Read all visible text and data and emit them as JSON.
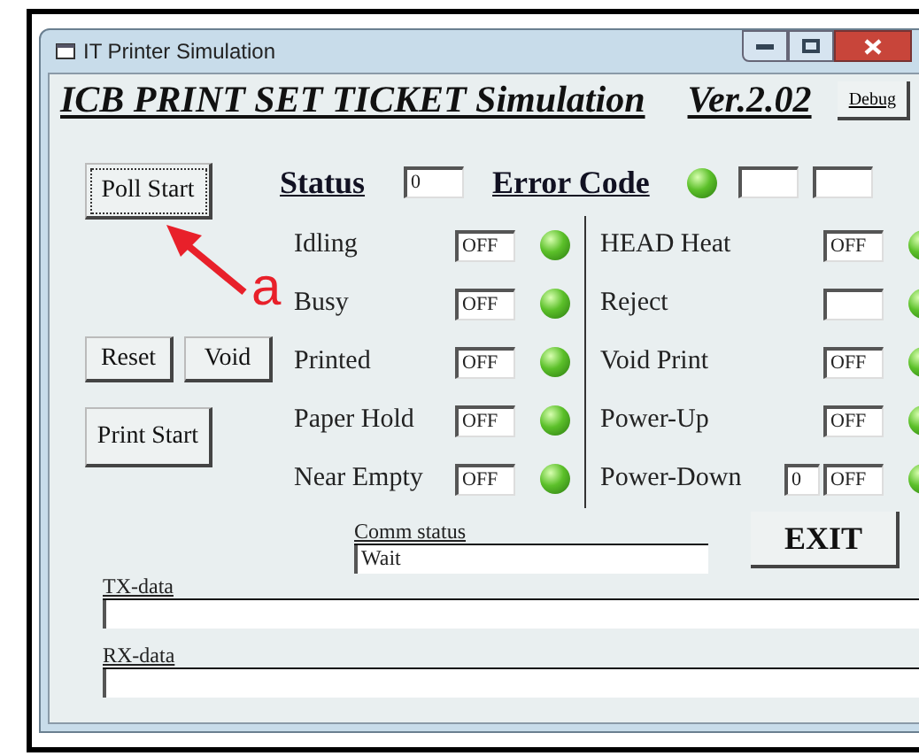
{
  "window": {
    "title": "IT Printer Simulation"
  },
  "header": {
    "title": "ICB PRINT SET TICKET Simulation",
    "version": "Ver.2.02",
    "debug_button": "Debug"
  },
  "buttons": {
    "poll_start": "Poll Start",
    "reset": "Reset",
    "void": "Void",
    "print_start": "Print Start",
    "exit": "EXIT"
  },
  "annotation": {
    "label": "a"
  },
  "status": {
    "label": "Status",
    "value": "0"
  },
  "error_code": {
    "label": "Error Code"
  },
  "indicators_left": [
    {
      "label": "Idling",
      "value": "OFF"
    },
    {
      "label": "Busy",
      "value": "OFF"
    },
    {
      "label": "Printed",
      "value": "OFF"
    },
    {
      "label": "Paper Hold",
      "value": "OFF"
    },
    {
      "label": "Near Empty",
      "value": "OFF"
    }
  ],
  "indicators_right": [
    {
      "label": "HEAD Heat",
      "value": "OFF"
    },
    {
      "label": "Reject"
    },
    {
      "label": "Void Print",
      "value": "OFF"
    },
    {
      "label": "Power-Up",
      "value": "OFF"
    },
    {
      "label": "Power-Down",
      "count": "0",
      "value": "OFF"
    }
  ],
  "comm_status": {
    "label": "Comm status",
    "value": "Wait"
  },
  "tx_data": {
    "label": "TX-data"
  },
  "rx_data": {
    "label": "RX-data"
  }
}
